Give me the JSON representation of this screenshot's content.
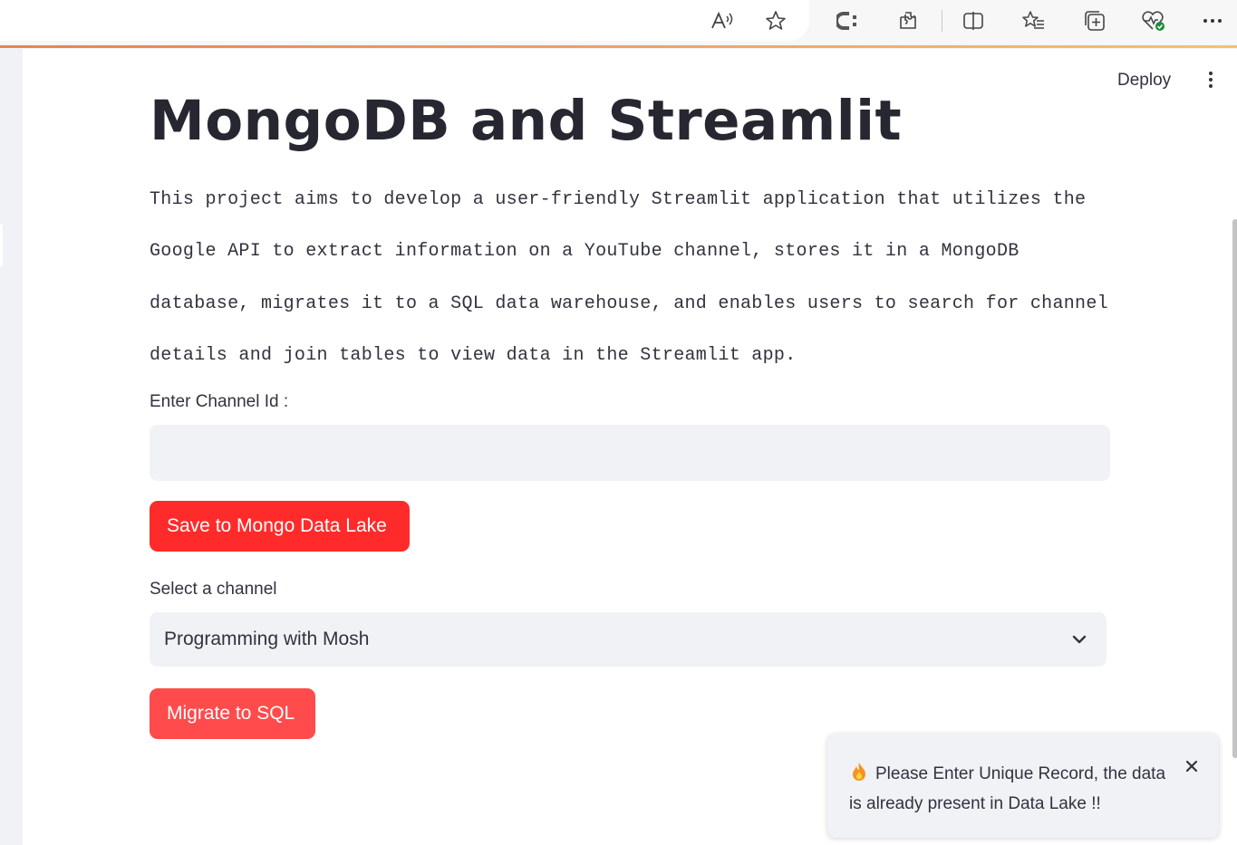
{
  "browser": {
    "icons": [
      "read-aloud-icon",
      "favorite-star-icon",
      "copilot-icon",
      "extensions-icon",
      "split-screen-icon",
      "favorites-list-icon",
      "collections-icon",
      "browser-essentials-icon",
      "more-icon"
    ]
  },
  "header": {
    "deploy_label": "Deploy"
  },
  "main": {
    "title": "MongoDB and Streamlit",
    "description": "This project aims to develop a user-friendly Streamlit application that utilizes the Google API to extract information on a YouTube channel, stores it in a MongoDB database, migrates it to a SQL data warehouse, and enables users to search for channel details and join tables to view data in the Streamlit app.",
    "channel_input": {
      "label": "Enter Channel Id :",
      "value": "",
      "placeholder": ""
    },
    "save_button": "Save to Mongo Data Lake",
    "select": {
      "label": "Select a channel",
      "value": "Programming with Mosh"
    },
    "migrate_button": "Migrate to SQL"
  },
  "toast": {
    "icon": "fire-icon",
    "message": "Please Enter Unique Record, the data is already present in Data Lake !!"
  },
  "colors": {
    "primary": "#ff4b4b",
    "primary_hover": "#ff2b2b",
    "input_bg": "#f0f2f6",
    "text": "#31333f"
  }
}
